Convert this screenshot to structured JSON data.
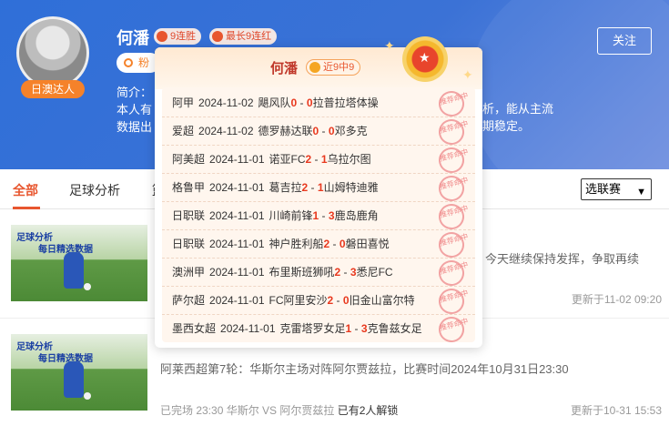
{
  "profile": {
    "name": "何潘",
    "tags": [
      "9连胜",
      "最长9连红"
    ],
    "fans_label": "粉丝",
    "follow_label": "关注",
    "avatar_badge": "日澳达人",
    "intro_lines": [
      "简介：",
      "本人有",
      "数据出"
    ],
    "intro_tail": [
      "析，能从主流",
      "期稳定。"
    ]
  },
  "tabs": {
    "items": [
      "全部",
      "足球分析"
    ],
    "more": "篮",
    "league_select": "选联赛"
  },
  "popup": {
    "title": "何潘",
    "badge": "近9中9",
    "stamp": "推荐命中",
    "rows": [
      {
        "league": "阿甲",
        "date": "2024-11-02",
        "home": "飓风队",
        "hs": "0",
        "as": "0",
        "away": "拉普拉塔体操"
      },
      {
        "league": "爱超",
        "date": "2024-11-02",
        "home": "德罗赫达联",
        "hs": "0",
        "as": "0",
        "away": "邓多克"
      },
      {
        "league": "阿美超",
        "date": "2024-11-01",
        "home": "诺亚FC",
        "hs": "2",
        "as": "1",
        "away": "乌拉尔图"
      },
      {
        "league": "格鲁甲",
        "date": "2024-11-01",
        "home": "葛吉拉",
        "hs": "2",
        "as": "1",
        "away": "山姆特迪雅"
      },
      {
        "league": "日职联",
        "date": "2024-11-01",
        "home": "川崎前锋",
        "hs": "1",
        "as": "3",
        "away": "鹿岛鹿角"
      },
      {
        "league": "日职联",
        "date": "2024-11-01",
        "home": "神户胜利船",
        "hs": "2",
        "as": "0",
        "away": "磐田喜悦"
      },
      {
        "league": "澳洲甲",
        "date": "2024-11-01",
        "home": "布里斯班狮吼",
        "hs": "2",
        "as": "3",
        "away": "悉尼FC"
      },
      {
        "league": "萨尔超",
        "date": "2024-11-01",
        "home": "FC阿里安沙",
        "hs": "2",
        "as": "0",
        "away": "旧金山富尔特"
      },
      {
        "league": "墨西女超",
        "date": "2024-11-01",
        "home": "克雷塔罗女足",
        "hs": "1",
        "as": "3",
        "away": "克鲁兹女足"
      }
    ]
  },
  "articles": [
    {
      "thumb_line1": "足球分析",
      "thumb_line2": "每日精选数据",
      "snippet": "今天继续保持发挥，争取再续",
      "updated": "更新于11-02 09:20"
    },
    {
      "thumb_line1": "足球分析",
      "thumb_line2": "每日精选数据",
      "title": "阿莱西超第7轮：华斯尔主场对阵阿尔贾兹拉，比赛时间2024年10月31日23:30",
      "meta_prefix": "已完场 23:30 华斯尔 VS 阿尔贾兹拉",
      "meta_unlock": "已有2人解锁",
      "updated": "更新于10-31 15:53"
    }
  ],
  "colors": {
    "header": "#3b72d6",
    "accent": "#e8562f",
    "score": "#e8391f"
  }
}
